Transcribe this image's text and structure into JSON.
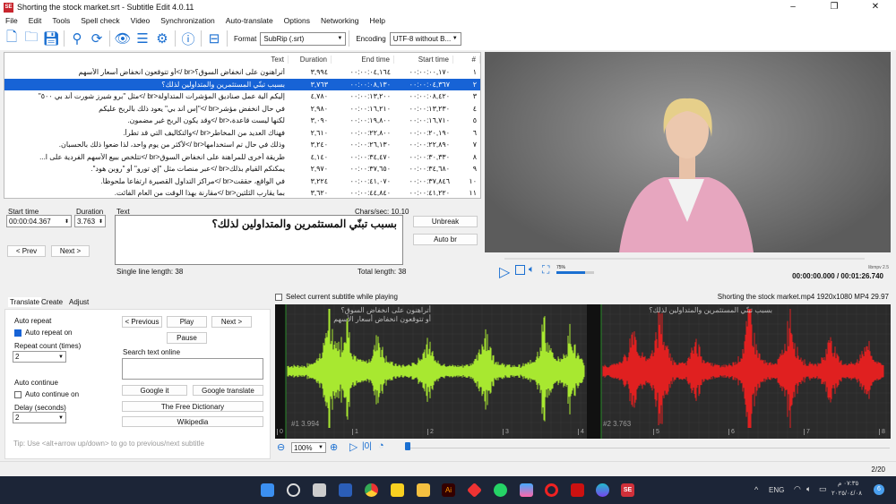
{
  "window": {
    "title": "Shorting the stock market.srt - Subtitle Edit 4.0.11"
  },
  "menu": [
    "File",
    "Edit",
    "Tools",
    "Spell check",
    "Video",
    "Synchronization",
    "Auto-translate",
    "Options",
    "Networking",
    "Help"
  ],
  "toolbar": {
    "format_label": "Format",
    "format_value": "SubRip (.srt)",
    "encoding_label": "Encoding",
    "encoding_value": "UTF-8 without B..."
  },
  "grid": {
    "headers": {
      "number": "#",
      "start": "Start time",
      "end": "End time",
      "duration": "Duration",
      "text": "Text"
    },
    "selected_index": 1,
    "rows": [
      {
        "n": "١",
        "start": "٠٠:٠٠:٠٠,١٧٠",
        "end": "٠٠:٠٠:٠٤,١٦٤",
        "duration": "٣,٩٩٤",
        "text": "أتراهنون على انخفاض السوق؟<br />أو تتوقعون انخفاض أسعار الأسهم"
      },
      {
        "n": "٢",
        "start": "٠٠:٠٠:٠٤,٣٦٧",
        "end": "٠٠:٠٠:٠٨,١٣٠",
        "duration": "٣,٧٦٣",
        "text": "بسبب تبنّي المستثمرين والمتداولين لذلك؟"
      },
      {
        "n": "٣",
        "start": "٠٠:٠٠:٠٨,٤٢٠",
        "end": "٠٠:٠٠:١٣,٢٠٠",
        "duration": "٤,٧٨٠",
        "text": "إليكم آلية عمل صناديق المؤشرات المتداولة<br />مثل \"برو شيرز شورت أند بي ٥٠٠\""
      },
      {
        "n": "٤",
        "start": "٠٠:٠٠:١٣,٢٣٠",
        "end": "٠٠:٠٠:١٦,٢١٠",
        "duration": "٢,٩٨٠",
        "text": "في حال انخفض مؤشر<br />\"إس آند بي\" يعود ذلك بالربح عليكم"
      },
      {
        "n": "٥",
        "start": "٠٠:٠٠:١٦,٧١٠",
        "end": "٠٠:٠٠:١٩,٨٠٠",
        "duration": "٣,٠٩٠",
        "text": "لكنها ليست قاعدة،<br />وقد يكون الربح غير مضمون."
      },
      {
        "n": "٦",
        "start": "٠٠:٠٠:٢٠,١٩٠",
        "end": "٠٠:٠٠:٢٢,٨٠٠",
        "duration": "٢,٦١٠",
        "text": "فهناك العديد من المخاطر<br />والتكاليف التي قد تطرأ."
      },
      {
        "n": "٧",
        "start": "٠٠:٠٠:٢٢,٨٩٠",
        "end": "٠٠:٠٠:٢٦,١٣٠",
        "duration": "٣,٢٤٠",
        "text": "وذلك في حال تم استخدامها<br />لأكثر من يوم واحد، لذا ضعوا ذلك بالحسبان."
      },
      {
        "n": "٨",
        "start": "٠٠:٠٠:٣٠,٣٣٠",
        "end": "٠٠:٠٠:٣٤,٤٧٠",
        "duration": "٤,١٤٠",
        "text": "طريقة أخرى للمراهنة على انخفاض السوق<br />تتلخص ببيع الأسهم الفردية على ا..."
      },
      {
        "n": "٩",
        "start": "٠٠:٠٠:٣٤,٦٨٠",
        "end": "٠٠:٠٠:٣٧,٦٥٠",
        "duration": "٢,٩٧٠",
        "text": "يمكنكم القيام بذلك<br />عبر منصات مثل \"إي تورو\" أو \"روبن هود\"."
      },
      {
        "n": "١٠",
        "start": "٠٠:٠٠:٣٧,٨٤٦",
        "end": "٠٠:٠٠:٤١,٠٧٠",
        "duration": "٣,٢٢٤",
        "text": "في الواقع، حققت<br />مراكز التداول القصيرة ارتفاعاً ملحوظاً."
      },
      {
        "n": "١١",
        "start": "٠٠:٠٠:٤١,٢٢٠",
        "end": "٠٠:٠٠:٤٤,٨٤٠",
        "duration": "٣,٦٢٠",
        "text": "بما يقارب الثلثين<br />مقارنة بهذا الوقت من العام الفائت."
      }
    ]
  },
  "video": {
    "volume_label": "75%",
    "volume": 0.75,
    "player": "libmpv 2.5",
    "time": "00:00:00.000 / 00:01:26.740"
  },
  "edit": {
    "start_label": "Start time",
    "start_value": "00:00:04.367",
    "duration_label": "Duration",
    "duration_value": "3.763",
    "text_label": "Text",
    "chars_sec": "Chars/sec: 10.10",
    "text_value": "بسبب تبنّي المستثمرين والمتداولين لذلك؟",
    "single_line": "Single line length: 38",
    "total_length": "Total length: 38",
    "prev": "< Prev",
    "next": "Next >",
    "unbreak": "Unbreak",
    "auto_br": "Auto br"
  },
  "tabs": [
    "Translate",
    "Create",
    "Adjust"
  ],
  "translate": {
    "auto_repeat": "Auto repeat",
    "auto_repeat_on": "Auto repeat on",
    "repeat_count": "Repeat count (times)",
    "repeat_value": "2",
    "auto_continue": "Auto continue",
    "auto_continue_on": "Auto continue on",
    "delay": "Delay (seconds)",
    "delay_value": "2",
    "previous": "< Previous",
    "play": "Play",
    "next": "Next >",
    "pause": "Pause",
    "search_label": "Search text online",
    "google_it": "Google it",
    "google_translate": "Google translate",
    "free_dictionary": "The Free Dictionary",
    "wikipedia": "Wikipedia",
    "tip": "Tip: Use <alt+arrow up/down> to go to previous/next subtitle"
  },
  "waveform": {
    "select_label": "Select current subtitle while playing",
    "media_info": "Shorting the stock market.mp4 1920x1080 MP4 29.97",
    "sub1_line1": "أتراهنون على انخفاض السوق؟",
    "sub1_line2": "أو تتوقعون انخفاض أسعار الأسهم",
    "sub1_info": "#1  3.994",
    "sub2_line1": "بسبب تبنّي المستثمرين والمتداولين لذلك؟",
    "sub2_info": "#2  3.763",
    "ticks": [
      "0",
      "1",
      "2",
      "3",
      "4",
      "5",
      "6",
      "7",
      "8"
    ],
    "zoom": "100%",
    "colors": {
      "sub1": "#a8e830",
      "sub2": "#e02020"
    }
  },
  "status": {
    "position": "2/20"
  },
  "taskbar": {
    "lang": "ENG",
    "time": "٠٧:٣٥ م",
    "date": "٢٠٢٥/٠٤/٠٨",
    "notifications": "6"
  }
}
